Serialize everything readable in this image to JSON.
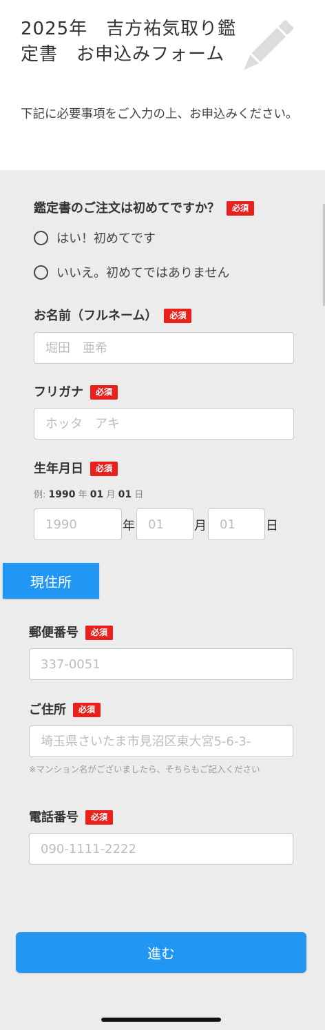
{
  "header": {
    "title": "2025年　吉方祐気取り鑑定書　お申込みフォーム",
    "intro": "下記に必要事項をご入力の上、お申込みください。",
    "icon": "pencil-icon"
  },
  "required_badge": "必須",
  "first_order": {
    "label": "鑑定書のご注文は初めてですか？",
    "options": [
      "はい！初めてです",
      "いいえ。初めてではありません"
    ]
  },
  "name": {
    "label": "お名前（フルネーム）",
    "placeholder": "堀田　亜希"
  },
  "furigana": {
    "label": "フリガナ",
    "placeholder": "ホッタ　アキ"
  },
  "birthdate": {
    "label": "生年月日",
    "example": {
      "prefix": "例:",
      "year": "1990",
      "year_unit": "年",
      "month": "01",
      "month_unit": "月",
      "day": "01",
      "day_unit": "日"
    },
    "year_placeholder": "1990",
    "month_placeholder": "01",
    "day_placeholder": "01",
    "year_unit": "年",
    "month_unit": "月",
    "day_unit": "日"
  },
  "address_section": {
    "label": "現住所"
  },
  "postal": {
    "label": "郵便番号",
    "placeholder": "337-0051"
  },
  "address": {
    "label": "ご住所",
    "placeholder": "埼玉県さいたま市見沼区東大宮5-6-3-",
    "note": "※マンション名がございましたら、そちらもご記入ください"
  },
  "phone": {
    "label": "電話番号",
    "placeholder": "090-1111-2222"
  },
  "submit": {
    "label": "進む"
  },
  "colors": {
    "accent": "#2196f3",
    "required": "#e8211c",
    "background": "#ececec"
  }
}
